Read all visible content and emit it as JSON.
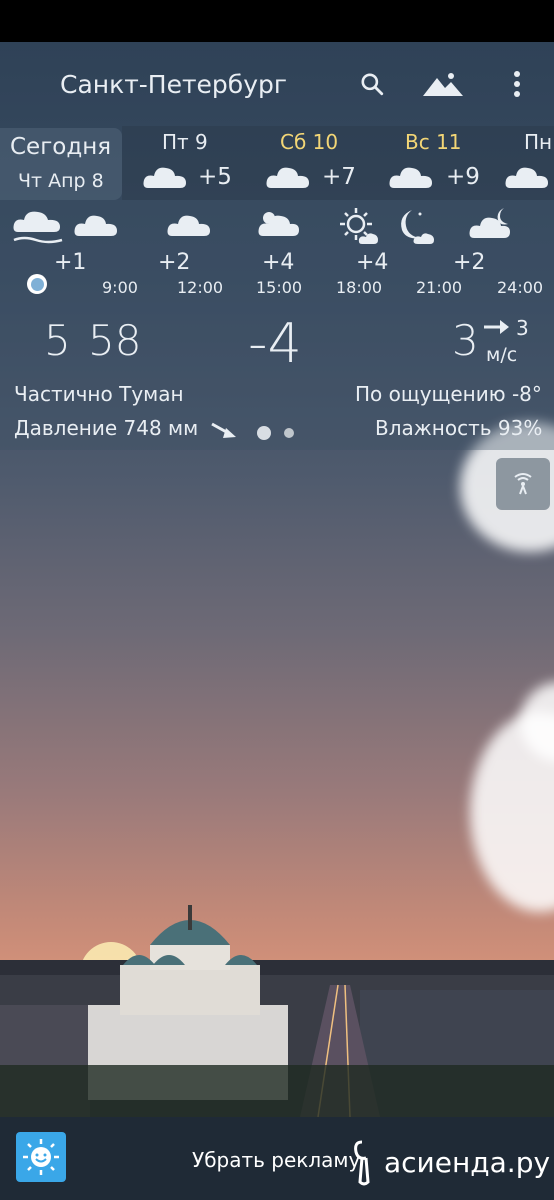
{
  "header": {
    "city": "Санкт-Петербург"
  },
  "icons": {
    "search": "search-icon",
    "mountains": "mountains-icon",
    "menu": "more-vert-icon",
    "radar": "radar-icon",
    "app": "sun-smile-icon"
  },
  "today": {
    "label": "Сегодня",
    "date": "Чт Апр 8"
  },
  "days": [
    {
      "name": "Пт 9",
      "temp": "+5",
      "weekend": false
    },
    {
      "name": "Сб 10",
      "temp": "+7",
      "weekend": true
    },
    {
      "name": "Вс 11",
      "temp": "+9",
      "weekend": true
    },
    {
      "name": "Пн",
      "temp": "",
      "weekend": false
    }
  ],
  "hourly": {
    "temps": [
      "+1",
      "+2",
      "+4",
      "+4",
      "+2"
    ],
    "times": [
      "9:00",
      "12:00",
      "15:00",
      "18:00",
      "21:00",
      "24:00"
    ]
  },
  "current": {
    "sunrise_h": "5",
    "sunrise_m": "58",
    "temp": "-4",
    "wind_speed": "3",
    "wind_small": "3",
    "wind_unit": "м/с",
    "condition": "Частично Туман",
    "feels_like": "По ощущению -8°",
    "pressure": "Давление 748 мм",
    "humidity": "Влажность 93%"
  },
  "footer": {
    "remove_ads": "Убрать рекламу",
    "watermark": "асиенда.ру"
  },
  "colors": {
    "weekend": "#f3d676",
    "bottom_bar": "#1f2a36"
  }
}
